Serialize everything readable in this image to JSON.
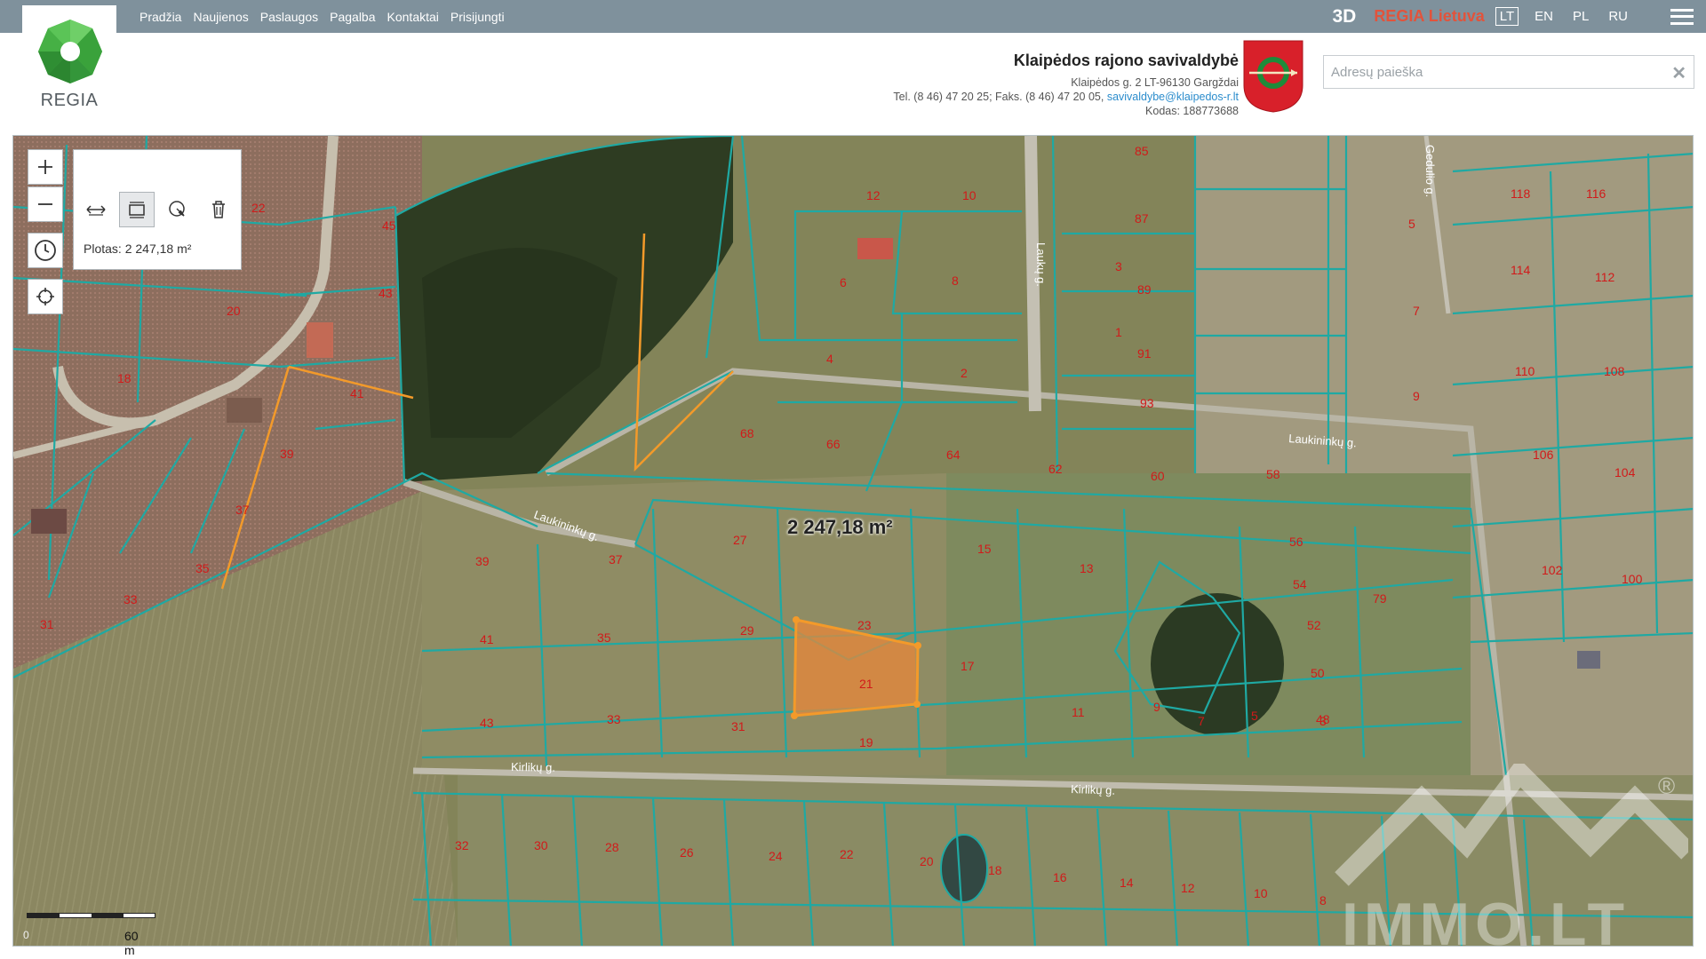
{
  "nav": {
    "items": [
      "Pradžia",
      "Naujienos",
      "Paslaugos",
      "Pagalba",
      "Kontaktai",
      "Prisijungti"
    ]
  },
  "top_right": {
    "three_d": "3D",
    "brand": "REGIA Lietuva",
    "languages": [
      "LT",
      "EN",
      "PL",
      "RU"
    ],
    "active_language": "LT"
  },
  "logo": {
    "text": "REGIA"
  },
  "municipality": {
    "title": "Klaipėdos rajono savivaldybė",
    "address": "Klaipėdos g. 2 LT-96130 Gargždai",
    "phone": "Tel. (8 46) 47 20 25; Faks. (8 46) 47 20 05,",
    "email": "savivaldybe@klaipedos-r.lt",
    "code": "Kodas: 188773688"
  },
  "search": {
    "placeholder": "Adresų paieška",
    "value": ""
  },
  "map": {
    "area_readout": "Plotas: 2 247,18 m²",
    "selected_area_label": "2 247,18 m²",
    "scale_zero": "0",
    "scale_label": "60 m",
    "streets": [
      "Laukų g.",
      "Laukininkų g.",
      "Kirlikų g.",
      "Gedulio g."
    ],
    "parcel_numbers": [
      "12",
      "10",
      "6",
      "8",
      "4",
      "2",
      "85",
      "87",
      "89",
      "91",
      "93",
      "118",
      "116",
      "5",
      "7",
      "9",
      "3",
      "1",
      "114",
      "112",
      "110",
      "108",
      "106",
      "104",
      "102",
      "100",
      "68",
      "66",
      "64",
      "62",
      "60",
      "58",
      "56",
      "54",
      "52",
      "50",
      "48",
      "27",
      "37",
      "39",
      "41",
      "43",
      "35",
      "33",
      "29",
      "31",
      "23",
      "21",
      "19",
      "15",
      "17",
      "13",
      "11",
      "9",
      "7",
      "5",
      "3",
      "45",
      "43",
      "20",
      "18",
      "41",
      "39",
      "37",
      "35",
      "33",
      "31",
      "22",
      "32",
      "30",
      "28",
      "26",
      "24",
      "22",
      "20",
      "18",
      "16",
      "14",
      "12",
      "10",
      "8",
      "79"
    ],
    "colors": {
      "parcel_line": "#1fa9a3",
      "selection": "#f39a2a",
      "parcel_number": "#d11a1a"
    }
  },
  "watermark": {
    "text": "IMMO.LT",
    "registered": "®"
  }
}
